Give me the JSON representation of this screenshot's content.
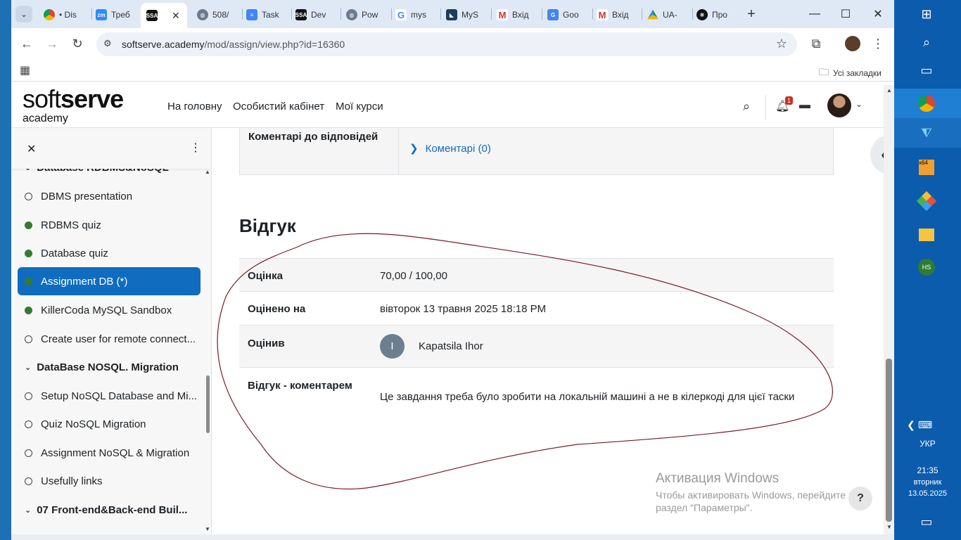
{
  "browser": {
    "tabs": [
      {
        "label": "• Dis",
        "icon": "chrome-icon"
      },
      {
        "label": "Треб",
        "icon": "zoom-icon"
      },
      {
        "label": "",
        "icon": "ssa-icon",
        "active": true
      },
      {
        "label": "508/",
        "icon": "globe-icon"
      },
      {
        "label": "Task",
        "icon": "docs-icon"
      },
      {
        "label": "Dev",
        "icon": "ssa-icon"
      },
      {
        "label": "Pow",
        "icon": "globe-icon"
      },
      {
        "label": "mys",
        "icon": "google-icon"
      },
      {
        "label": "MyS",
        "icon": "mysql-icon"
      },
      {
        "label": "Вхід",
        "icon": "gmail-icon"
      },
      {
        "label": "Goo",
        "icon": "translate-icon"
      },
      {
        "label": "Вхід",
        "icon": "gmail-icon"
      },
      {
        "label": "UA-",
        "icon": "drive-icon"
      },
      {
        "label": "Про",
        "icon": "chatgpt-icon"
      }
    ],
    "url_host": "softserve.academy",
    "url_path": "/mod/assign/view.php?id=16360",
    "bookmarks_label": "Усі закладки"
  },
  "site": {
    "logo_soft": "soft",
    "logo_serve": "serve",
    "logo_academy": "academy",
    "nav": [
      "На головну",
      "Особистий кабінет",
      "Мої курси"
    ],
    "notification_count": "1"
  },
  "drawer": {
    "partial_section": "Database RDBMS&NoSQL",
    "items": [
      {
        "label": "DBMS presentation",
        "done": false
      },
      {
        "label": "RDBMS quiz",
        "done": true
      },
      {
        "label": "Database quiz",
        "done": true
      },
      {
        "label": "Assignment DB (*)",
        "done": true,
        "active": true
      },
      {
        "label": "KillerCoda MySQL Sandbox",
        "done": true
      },
      {
        "label": "Create user for remote connect...",
        "done": false
      }
    ],
    "section2": "DataBase NOSQL. Migration",
    "items2": [
      {
        "label": "Setup NoSQL Database and Mi...",
        "done": false
      },
      {
        "label": "Quiz NoSQL Migration",
        "done": false
      },
      {
        "label": "Assignment NoSQL & Migration",
        "done": false
      },
      {
        "label": "Usefully links",
        "done": false
      }
    ],
    "section3": "07 Front-end&Back-end Buil..."
  },
  "submission": {
    "comments_label": "Коментарі до відповідей",
    "comments_link": "Коментарі (0)"
  },
  "feedback": {
    "heading": "Відгук",
    "grade_label": "Оцінка",
    "grade_value": "70,00 / 100,00",
    "graded_on_label": "Оцінено на",
    "graded_on_value": "вівторок 13 травня 2025 18:18 PM",
    "graded_by_label": "Оцінив",
    "grader_initial": "I",
    "grader_name": "Kapatsila Ihor",
    "comment_label": "Відгук - коментарем",
    "comment_value": "Це завдання треба було зробити на локальній машині а не в кілеркоді для цієї таски"
  },
  "watermark": {
    "title": "Активация Windows",
    "line1": "Чтобы активировать Windows, перейдите в",
    "line2": "раздел \"Параметры\"."
  },
  "help_label": "?",
  "taskbar": {
    "lang": "УКР",
    "time": "21:35",
    "day": "вторник",
    "date": "13.05.2025"
  },
  "colors": {
    "accent": "#0f6cbf",
    "done_dot": "#357a32",
    "annotation": "#7a1a2a"
  }
}
